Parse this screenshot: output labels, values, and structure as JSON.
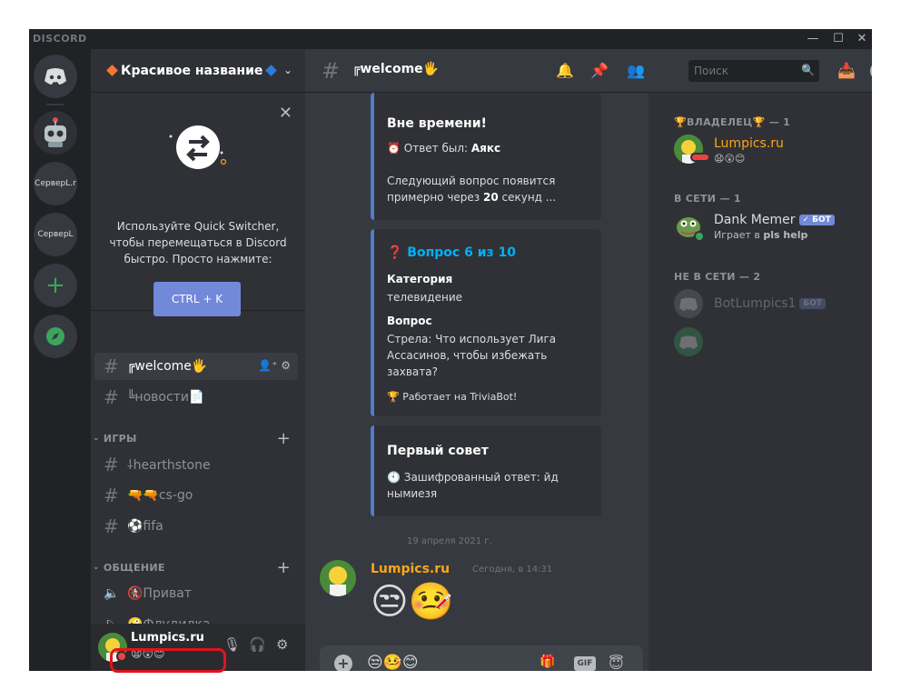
{
  "window": {
    "brand": "DISCORD",
    "controls": {
      "minimize": "—",
      "maximize": "☐",
      "close": "✕"
    }
  },
  "servers": [
    {
      "label": "",
      "icon": "discord-home-icon"
    },
    {
      "label": "",
      "icon": "robot-icon"
    },
    {
      "label": "СерверL.r",
      "icon": ""
    },
    {
      "label": "СерверL",
      "icon": ""
    },
    {
      "label": "+",
      "icon": "plus-icon"
    },
    {
      "label": "",
      "icon": "compass-icon"
    }
  ],
  "guild": {
    "name": "Красивое название",
    "diamond_left_color": "#f57731",
    "diamond_right_color": "#2f7bdc"
  },
  "switcher": {
    "close": "✕",
    "description": "Используйте Quick Switcher, чтобы перемещаться в Discord быстро. Просто нажмите:",
    "shortcut": "CTRL + K"
  },
  "channels": {
    "top": [
      {
        "label": "╔welcome🖐"
      },
      {
        "label": "╚новости📄"
      }
    ],
    "cat_games": "ИГРЫ",
    "games": [
      {
        "label": "⸸hearthstone"
      },
      {
        "label": "🔫🔫cs-go"
      },
      {
        "label": "⚽fifa"
      }
    ],
    "cat_social": "ОБЩЕНИЕ",
    "voice": [
      {
        "label": "🚷Приват"
      },
      {
        "label": "🤪Флудилка"
      }
    ]
  },
  "user": {
    "name": "Lumpics.ru",
    "status": "😧😲😊"
  },
  "chat": {
    "channel_title": "╔welcome🖐",
    "search_placeholder": "Поиск",
    "embed1": {
      "cut_title": "Вне времени!",
      "answer_prefix": "⏰ Ответ был: ",
      "answer_value": "Аякс",
      "next_line1_prefix": "Следующий вопрос появится",
      "next_line2_prefix": "примерно через ",
      "next_seconds": "20",
      "next_line2_suffix": " секунд ..."
    },
    "embed2": {
      "title": "❓ Вопрос 6 из 10",
      "category_label": "Категория",
      "category_value": "телевидение",
      "question_label": "Вопрос",
      "question_line1": "Стрела: Что использует Лига",
      "question_line2": "Ассасинов, чтобы избежать",
      "question_line3": "захвата?",
      "footer": "🏆  Работает на TriviaBot!"
    },
    "embed3": {
      "title": "Первый совет",
      "line1": "🕙 Зашифрованный ответ: йд",
      "line2": "нымиезя"
    },
    "date_divider": "19 апреля 2021 г.",
    "message": {
      "author": "Lumpics.ru",
      "time": "Сегодня, в 14:31",
      "emoji": "😒🤒"
    },
    "composer_emoji": "😒🤒😊"
  },
  "members": {
    "owner_category": "🏆ВЛАДЕЛЕЦ🏆 — 1",
    "owner": {
      "name": "Lumpics.ru",
      "status": "😧😲😊",
      "color": "#faa61a"
    },
    "online_category": "В СЕТИ — 1",
    "online": {
      "name": "Dank Memer",
      "badge": "✓ БОТ",
      "activity_prefix": "Играет в ",
      "activity_game": "pls help"
    },
    "offline_category": "НЕ В СЕТИ — 2",
    "offline": [
      {
        "name": "BotLumpics1",
        "badge": "БОТ"
      },
      {
        "name": "",
        "badge": ""
      }
    ]
  }
}
